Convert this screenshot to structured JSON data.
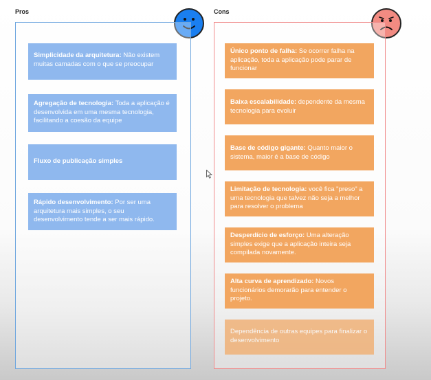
{
  "pros": {
    "heading": "Pros",
    "face_icon": "smiley-face-icon",
    "color": "#1a7ff0",
    "border_color": "#6fa7df",
    "items": [
      {
        "title": "Simplicidade da arquitetura:",
        "text": " Não existem muitas camadas com o que se preocupar"
      },
      {
        "title": "Agregação de tecnologia:",
        "text": " Toda a aplicação é desenvolvida em uma mesma tecnologia, facilitando a coesão da equipe"
      },
      {
        "title": "Fluxo de publicação simples",
        "text": ""
      },
      {
        "title": "Rápido desenvolvimento:",
        "text": " Por ser uma arquitetura mais simples, o seu desenvolvimento tende a ser mais rápido."
      }
    ]
  },
  "cons": {
    "heading": "Cons",
    "face_icon": "sad-face-icon",
    "color": "#f28b82",
    "border_color": "#f08a8a",
    "items": [
      {
        "title": "Único ponto de falha:",
        "text": " Se ocorrer falha na aplicação, toda a aplicação pode parar de funcionar"
      },
      {
        "title": "Baixa escalabilidade:",
        "text": " dependente da mesma tecnologia para evoluir"
      },
      {
        "title": "Base de código gigante:",
        "text": " Quanto maior o sistema, maior é a base de código"
      },
      {
        "title": "Limitação de tecnologia:",
        "text": " você fica \"preso\" a uma tecnologia que talvez não seja a melhor para resolver o problema"
      },
      {
        "title": "Desperdício de esforço:",
        "text": " Uma alteração simples exige que a aplicação inteira seja compilada novamente."
      },
      {
        "title": "Alta curva de aprendizado:",
        "text": " Novos funcionários demorarão para entender o projeto."
      },
      {
        "title": "",
        "text": "Dependência de outras equipes para finalizar o desenvolvimento"
      }
    ]
  },
  "cursor_icon": "mouse-pointer-icon"
}
